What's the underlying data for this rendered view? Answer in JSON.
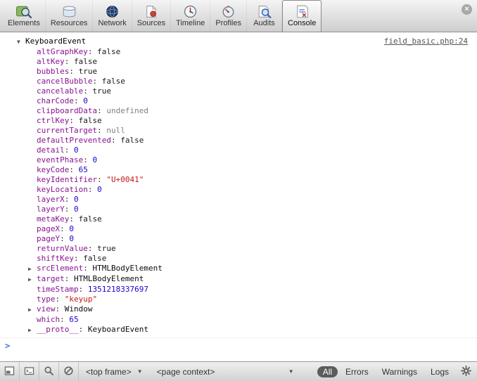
{
  "window": {
    "close_icon": "×"
  },
  "toolbar": {
    "tabs": [
      {
        "id": "elements",
        "label": "Elements",
        "icon": "elements-icon",
        "selected": false
      },
      {
        "id": "resources",
        "label": "Resources",
        "icon": "resources-icon",
        "selected": false
      },
      {
        "id": "network",
        "label": "Network",
        "icon": "network-icon",
        "selected": false
      },
      {
        "id": "sources",
        "label": "Sources",
        "icon": "sources-icon",
        "selected": false
      },
      {
        "id": "timeline",
        "label": "Timeline",
        "icon": "timeline-icon",
        "selected": false
      },
      {
        "id": "profiles",
        "label": "Profiles",
        "icon": "profiles-icon",
        "selected": false
      },
      {
        "id": "audits",
        "label": "Audits",
        "icon": "audits-icon",
        "selected": false
      },
      {
        "id": "console",
        "label": "Console",
        "icon": "console-icon",
        "selected": true
      }
    ]
  },
  "console": {
    "source_link": "field_basic.php:24",
    "root_object": "KeyboardEvent",
    "prompt_caret": ">",
    "properties": [
      {
        "name": "altGraphKey",
        "value": "false",
        "type": "boolean",
        "expandable": false
      },
      {
        "name": "altKey",
        "value": "false",
        "type": "boolean",
        "expandable": false
      },
      {
        "name": "bubbles",
        "value": "true",
        "type": "boolean",
        "expandable": false
      },
      {
        "name": "cancelBubble",
        "value": "false",
        "type": "boolean",
        "expandable": false
      },
      {
        "name": "cancelable",
        "value": "true",
        "type": "boolean",
        "expandable": false
      },
      {
        "name": "charCode",
        "value": "0",
        "type": "number",
        "expandable": false
      },
      {
        "name": "clipboardData",
        "value": "undefined",
        "type": "undefined",
        "expandable": false
      },
      {
        "name": "ctrlKey",
        "value": "false",
        "type": "boolean",
        "expandable": false
      },
      {
        "name": "currentTarget",
        "value": "null",
        "type": "null",
        "expandable": false
      },
      {
        "name": "defaultPrevented",
        "value": "false",
        "type": "boolean",
        "expandable": false
      },
      {
        "name": "detail",
        "value": "0",
        "type": "number",
        "expandable": false
      },
      {
        "name": "eventPhase",
        "value": "0",
        "type": "number",
        "expandable": false
      },
      {
        "name": "keyCode",
        "value": "65",
        "type": "number",
        "expandable": false
      },
      {
        "name": "keyIdentifier",
        "value": "\"U+0041\"",
        "type": "string",
        "expandable": false
      },
      {
        "name": "keyLocation",
        "value": "0",
        "type": "number",
        "expandable": false
      },
      {
        "name": "layerX",
        "value": "0",
        "type": "number",
        "expandable": false
      },
      {
        "name": "layerY",
        "value": "0",
        "type": "number",
        "expandable": false
      },
      {
        "name": "metaKey",
        "value": "false",
        "type": "boolean",
        "expandable": false
      },
      {
        "name": "pageX",
        "value": "0",
        "type": "number",
        "expandable": false
      },
      {
        "name": "pageY",
        "value": "0",
        "type": "number",
        "expandable": false
      },
      {
        "name": "returnValue",
        "value": "true",
        "type": "boolean",
        "expandable": false
      },
      {
        "name": "shiftKey",
        "value": "false",
        "type": "boolean",
        "expandable": false
      },
      {
        "name": "srcElement",
        "value": "HTMLBodyElement",
        "type": "object",
        "expandable": true
      },
      {
        "name": "target",
        "value": "HTMLBodyElement",
        "type": "object",
        "expandable": true
      },
      {
        "name": "timeStamp",
        "value": "1351218337697",
        "type": "number",
        "expandable": false
      },
      {
        "name": "type",
        "value": "\"keyup\"",
        "type": "string",
        "expandable": false
      },
      {
        "name": "view",
        "value": "Window",
        "type": "object",
        "expandable": true
      },
      {
        "name": "which",
        "value": "65",
        "type": "number",
        "expandable": false
      },
      {
        "name": "__proto__",
        "value": "KeyboardEvent",
        "type": "object",
        "expandable": true
      }
    ]
  },
  "statusbar": {
    "left_icons": [
      "dock-icon",
      "show-console-icon",
      "search-icon",
      "clear-console-icon"
    ],
    "frame_selector": "<top frame>",
    "context_selector": "<page context>",
    "filters": [
      {
        "label": "All",
        "selected": true
      },
      {
        "label": "Errors",
        "selected": false
      },
      {
        "label": "Warnings",
        "selected": false
      },
      {
        "label": "Logs",
        "selected": false
      }
    ],
    "gear": "gear-icon"
  }
}
